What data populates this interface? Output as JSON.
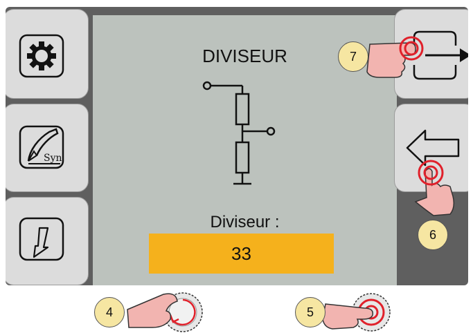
{
  "screen": {
    "title": "DIVISEUR",
    "parameter_label": "Diviseur :",
    "parameter_value": "33"
  },
  "left_buttons": [
    {
      "icon": "gear-icon"
    },
    {
      "icon": "synergic-torch-icon",
      "text": "Syn"
    },
    {
      "icon": "trigger-arrow-icon"
    }
  ],
  "right_buttons": [
    {
      "icon": "enter-arrow-icon"
    },
    {
      "icon": "back-arrow-icon"
    }
  ],
  "callouts": {
    "c4": "4",
    "c5": "5",
    "c6": "6",
    "c7": "7"
  },
  "colors": {
    "screen_frame": "#5f5f5f",
    "panel_bg": "#bcc2bd",
    "value_box": "#f5b11c",
    "callout_badge": "#f6e6a2",
    "touch_red": "#e0202a"
  }
}
